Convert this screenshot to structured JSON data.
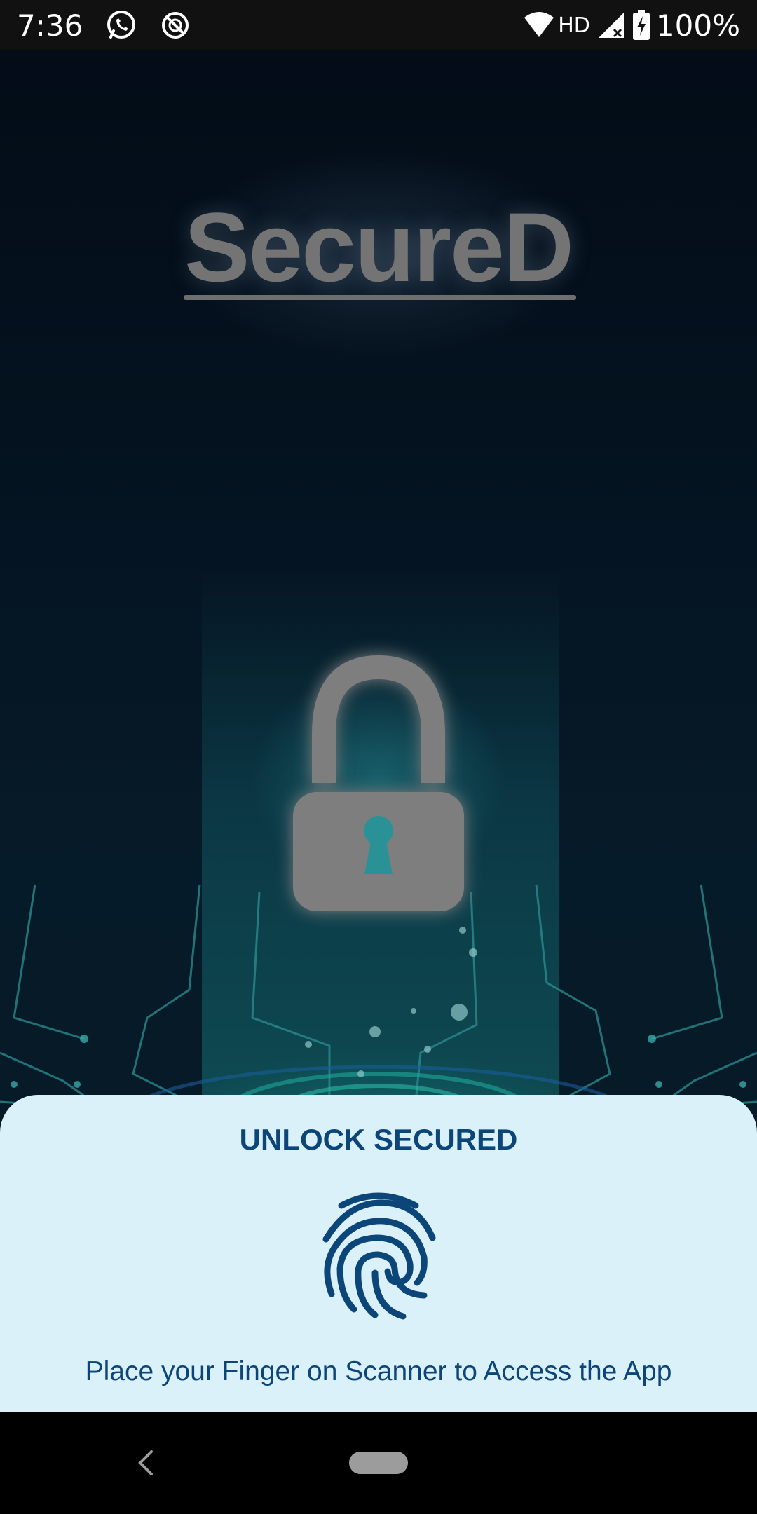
{
  "status_bar": {
    "time": "7:36",
    "left_icons": [
      "whatsapp-icon",
      "blocked-notification-icon"
    ],
    "network_type": "HD",
    "battery_percent": "100%",
    "right_icons": [
      "wifi-icon",
      "signal-icon",
      "battery-charging-icon"
    ]
  },
  "splash": {
    "app_name": "SecureD",
    "graphic": "padlock-icon",
    "colors": {
      "background": "#051523",
      "glow": "#1a8c8c",
      "logo": "#747474"
    }
  },
  "unlock_sheet": {
    "title": "UNLOCK SECURED",
    "icon": "fingerprint-icon",
    "instruction": "Place your Finger on Scanner to Access the App",
    "colors": {
      "background": "#dbf1fa",
      "text": "#0c4679"
    }
  },
  "nav_bar": {
    "back_icon": "back-chevron-icon",
    "home_icon": "home-pill-icon"
  }
}
